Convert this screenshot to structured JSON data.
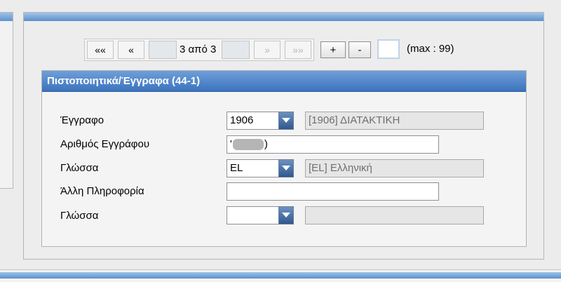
{
  "pagination": {
    "first": "««",
    "prev": "«",
    "status": "3 από 3",
    "next": "»",
    "last": "»»",
    "add": "+",
    "remove": "-",
    "page_input_value": "",
    "max_label": "(max : 99)"
  },
  "section": {
    "title": "Πιστοποιητικά/Έγγραφα (44-1)"
  },
  "form": {
    "document": {
      "label": "Έγγραφο",
      "value": "1906",
      "description": "[1906] ΔΙΑΤΑΚΤΙΚΗ"
    },
    "document_number": {
      "label": "Αριθμός Εγγράφου",
      "prefix": "'",
      "suffix": ")"
    },
    "language": {
      "label": "Γλώσσα",
      "value": "EL",
      "description": "[EL] Ελληνική"
    },
    "other_info": {
      "label": "Άλλη Πληροφορία",
      "value": ""
    },
    "language2": {
      "label": "Γλώσσα",
      "value": "",
      "description": ""
    }
  },
  "colors": {
    "header_blue": "#3b73bd",
    "dropdown_blue": "#2f5890"
  }
}
